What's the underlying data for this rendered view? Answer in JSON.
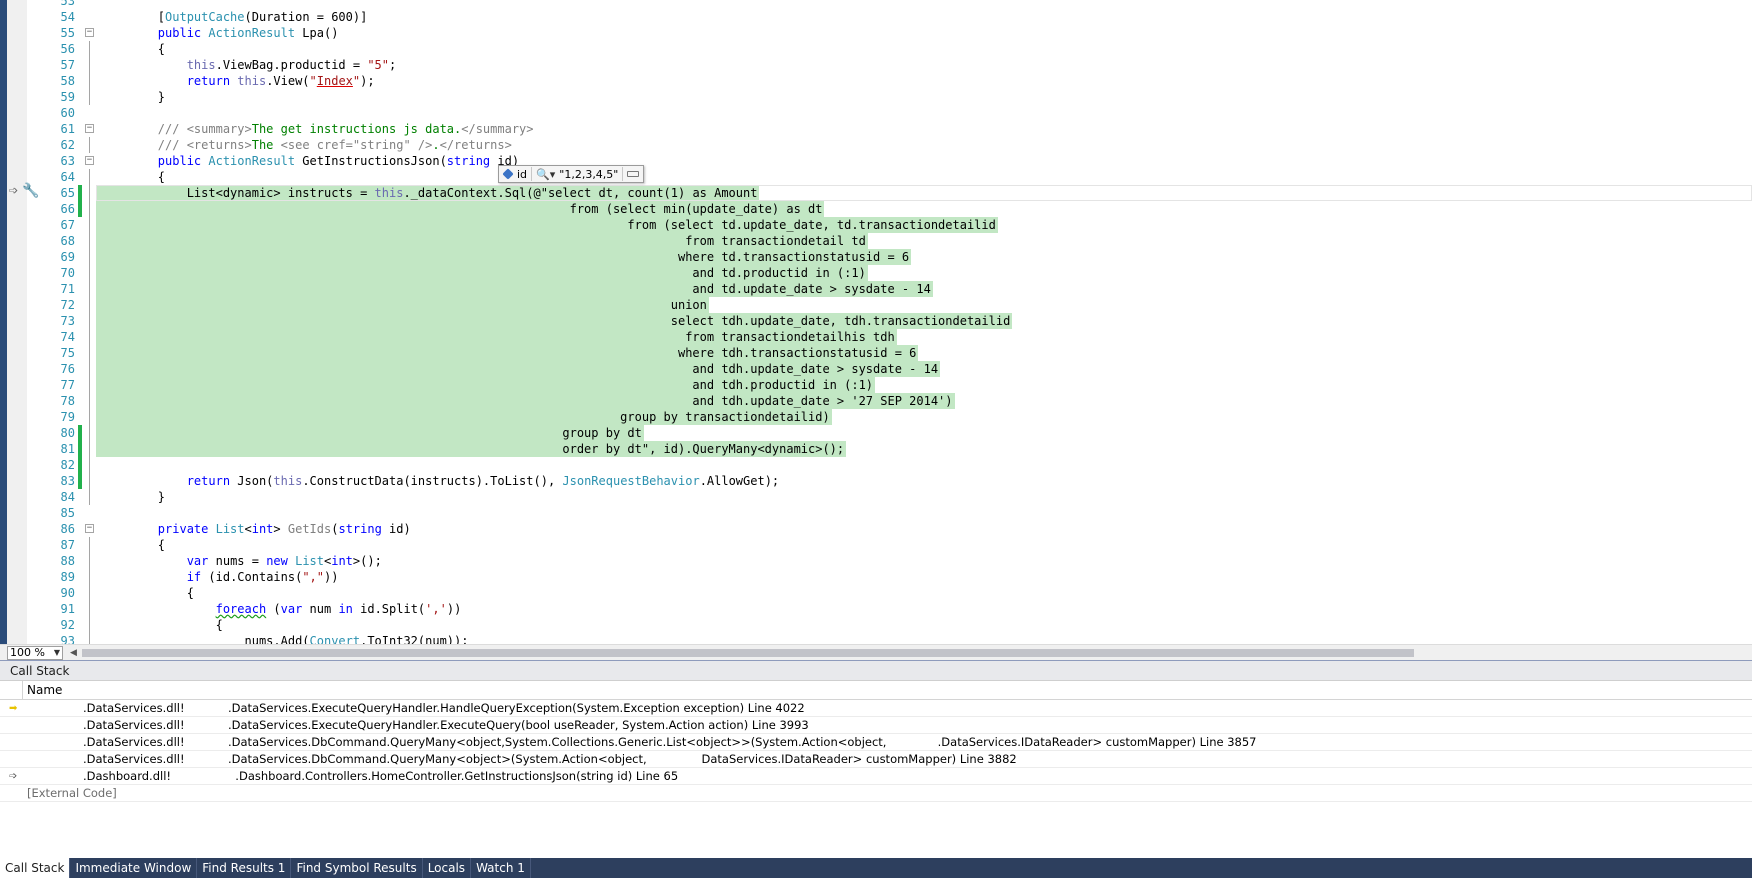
{
  "editor": {
    "lines": [
      {
        "n": "53",
        "tokens": [],
        "fold": "",
        "chg": "",
        "hl": ""
      },
      {
        "n": "54",
        "tokens": [
          [
            "        [",
            "plain"
          ],
          [
            "OutputCache",
            "type"
          ],
          [
            "(Duration = 600)]",
            "plain"
          ]
        ],
        "fold": "",
        "chg": "",
        "hl": ""
      },
      {
        "n": "55",
        "tokens": [
          [
            "        ",
            "plain"
          ],
          [
            "public ",
            "kw"
          ],
          [
            "ActionResult",
            "type"
          ],
          [
            " Lpa()",
            "plain"
          ]
        ],
        "fold": "minus",
        "chg": "",
        "hl": ""
      },
      {
        "n": "56",
        "tokens": [
          [
            "        {",
            "plain"
          ]
        ],
        "fold": "line",
        "chg": "",
        "hl": ""
      },
      {
        "n": "57",
        "tokens": [
          [
            "            ",
            "plain"
          ],
          [
            "this",
            "thisk"
          ],
          [
            ".ViewBag.productid = ",
            "plain"
          ],
          [
            "\"5\"",
            "str"
          ],
          [
            ";",
            "plain"
          ]
        ],
        "fold": "line",
        "chg": "",
        "hl": ""
      },
      {
        "n": "58",
        "tokens": [
          [
            "            ",
            "plain"
          ],
          [
            "return ",
            "kw"
          ],
          [
            "this",
            "thisk"
          ],
          [
            ".View(",
            "plain"
          ],
          [
            "\"",
            "str"
          ],
          [
            "Index",
            "str-u"
          ],
          [
            "\"",
            "str"
          ],
          [
            ");",
            "plain"
          ]
        ],
        "fold": "line",
        "chg": "",
        "hl": ""
      },
      {
        "n": "59",
        "tokens": [
          [
            "        }",
            "plain"
          ]
        ],
        "fold": "line",
        "chg": "",
        "hl": ""
      },
      {
        "n": "60",
        "tokens": [],
        "fold": "",
        "chg": "",
        "hl": ""
      },
      {
        "n": "61",
        "tokens": [
          [
            "        ",
            "plain"
          ],
          [
            "/// ",
            "tag"
          ],
          [
            "<summary>",
            "tag"
          ],
          [
            "The get instructions js data.",
            "cmt"
          ],
          [
            "</summary>",
            "tag"
          ]
        ],
        "fold": "minus",
        "chg": "",
        "hl": ""
      },
      {
        "n": "62",
        "tokens": [
          [
            "        ",
            "plain"
          ],
          [
            "/// ",
            "tag"
          ],
          [
            "<returns>",
            "tag"
          ],
          [
            "The ",
            "cmt"
          ],
          [
            "<see cref=\"string\" />",
            "tag"
          ],
          [
            ".",
            "cmt"
          ],
          [
            "</returns>",
            "tag"
          ]
        ],
        "fold": "line",
        "chg": "",
        "hl": ""
      },
      {
        "n": "63",
        "tokens": [
          [
            "        ",
            "plain"
          ],
          [
            "public ",
            "kw"
          ],
          [
            "ActionResult",
            "type"
          ],
          [
            " GetInstructionsJson(",
            "plain"
          ],
          [
            "string",
            "kw"
          ],
          [
            " id)",
            "plain"
          ]
        ],
        "fold": "minus",
        "chg": "",
        "hl": ""
      },
      {
        "n": "64",
        "tokens": [
          [
            "        {",
            "plain"
          ]
        ],
        "fold": "line",
        "chg": "",
        "hl": ""
      },
      {
        "n": "65",
        "tokens": [
          [
            "            List<dynamic> instructs = ",
            "plain"
          ],
          [
            "this",
            "thisk"
          ],
          [
            "._dataContext.Sql(@\"select dt, count(1) as Amount",
            "plain"
          ]
        ],
        "fold": "line",
        "chg": "saved",
        "hl": "cur"
      },
      {
        "n": "66",
        "tokens": [
          [
            "                                                                 from (select min(update_date) as dt",
            "plain"
          ]
        ],
        "fold": "line",
        "chg": "saved",
        "hl": "sel"
      },
      {
        "n": "67",
        "tokens": [
          [
            "                                                                         from (select td.update_date, td.transactiondetailid",
            "plain"
          ]
        ],
        "fold": "line",
        "chg": "",
        "hl": "sel"
      },
      {
        "n": "68",
        "tokens": [
          [
            "                                                                                 from transactiondetail td",
            "plain"
          ]
        ],
        "fold": "line",
        "chg": "",
        "hl": "sel"
      },
      {
        "n": "69",
        "tokens": [
          [
            "                                                                                where td.transactionstatusid = 6",
            "plain"
          ]
        ],
        "fold": "line",
        "chg": "",
        "hl": "sel"
      },
      {
        "n": "70",
        "tokens": [
          [
            "                                                                                  and td.productid in (:1)",
            "plain"
          ]
        ],
        "fold": "line",
        "chg": "",
        "hl": "sel"
      },
      {
        "n": "71",
        "tokens": [
          [
            "                                                                                  and td.update_date > sysdate - 14",
            "plain"
          ]
        ],
        "fold": "line",
        "chg": "",
        "hl": "sel"
      },
      {
        "n": "72",
        "tokens": [
          [
            "                                                                               union",
            "plain"
          ]
        ],
        "fold": "line",
        "chg": "",
        "hl": "sel"
      },
      {
        "n": "73",
        "tokens": [
          [
            "                                                                               select tdh.update_date, tdh.transactiondetailid",
            "plain"
          ]
        ],
        "fold": "line",
        "chg": "",
        "hl": "sel"
      },
      {
        "n": "74",
        "tokens": [
          [
            "                                                                                 from transactiondetailhis tdh",
            "plain"
          ]
        ],
        "fold": "line",
        "chg": "",
        "hl": "sel"
      },
      {
        "n": "75",
        "tokens": [
          [
            "                                                                                where tdh.transactionstatusid = 6",
            "plain"
          ]
        ],
        "fold": "line",
        "chg": "",
        "hl": "sel"
      },
      {
        "n": "76",
        "tokens": [
          [
            "                                                                                  and tdh.update_date > sysdate - 14",
            "plain"
          ]
        ],
        "fold": "line",
        "chg": "",
        "hl": "sel"
      },
      {
        "n": "77",
        "tokens": [
          [
            "                                                                                  and tdh.productid in (:1)",
            "plain"
          ]
        ],
        "fold": "line",
        "chg": "",
        "hl": "sel"
      },
      {
        "n": "78",
        "tokens": [
          [
            "                                                                                  and tdh.update_date > '27 SEP 2014')",
            "plain"
          ]
        ],
        "fold": "line",
        "chg": "",
        "hl": "sel"
      },
      {
        "n": "79",
        "tokens": [
          [
            "                                                                        group by transactiondetailid)",
            "plain"
          ]
        ],
        "fold": "line",
        "chg": "",
        "hl": "sel"
      },
      {
        "n": "80",
        "tokens": [
          [
            "                                                                group by dt",
            "plain"
          ]
        ],
        "fold": "line",
        "chg": "saved",
        "hl": "sel"
      },
      {
        "n": "81",
        "tokens": [
          [
            "                                                                order by dt\", id).QueryMany<dynamic>();",
            "plain"
          ]
        ],
        "fold": "line",
        "chg": "saved",
        "hl": "sel"
      },
      {
        "n": "82",
        "tokens": [],
        "fold": "line",
        "chg": "saved",
        "hl": ""
      },
      {
        "n": "83",
        "tokens": [
          [
            "            ",
            "plain"
          ],
          [
            "return ",
            "kw"
          ],
          [
            "Json(",
            "plain"
          ],
          [
            "this",
            "thisk"
          ],
          [
            ".ConstructData(instructs).ToList(), ",
            "plain"
          ],
          [
            "JsonRequestBehavior",
            "type"
          ],
          [
            ".AllowGet);",
            "plain"
          ]
        ],
        "fold": "line",
        "chg": "saved",
        "hl": ""
      },
      {
        "n": "84",
        "tokens": [
          [
            "        }",
            "plain"
          ]
        ],
        "fold": "line",
        "chg": "",
        "hl": ""
      },
      {
        "n": "85",
        "tokens": [],
        "fold": "",
        "chg": "",
        "hl": ""
      },
      {
        "n": "86",
        "tokens": [
          [
            "        ",
            "plain"
          ],
          [
            "private ",
            "kw"
          ],
          [
            "List",
            "type"
          ],
          [
            "<",
            "plain"
          ],
          [
            "int",
            "kw"
          ],
          [
            "> ",
            "plain"
          ],
          [
            "GetIds",
            "gray"
          ],
          [
            "(",
            "plain"
          ],
          [
            "string",
            "kw"
          ],
          [
            " id)",
            "plain"
          ]
        ],
        "fold": "minus",
        "chg": "",
        "hl": ""
      },
      {
        "n": "87",
        "tokens": [
          [
            "        {",
            "plain"
          ]
        ],
        "fold": "line",
        "chg": "",
        "hl": ""
      },
      {
        "n": "88",
        "tokens": [
          [
            "            ",
            "plain"
          ],
          [
            "var",
            "kw"
          ],
          [
            " nums = ",
            "plain"
          ],
          [
            "new ",
            "kw"
          ],
          [
            "List",
            "type"
          ],
          [
            "<",
            "plain"
          ],
          [
            "int",
            "kw"
          ],
          [
            ">();",
            "plain"
          ]
        ],
        "fold": "line",
        "chg": "",
        "hl": ""
      },
      {
        "n": "89",
        "tokens": [
          [
            "            ",
            "plain"
          ],
          [
            "if ",
            "kw"
          ],
          [
            "(id.Contains(",
            "plain"
          ],
          [
            "\",\"",
            "str"
          ],
          [
            "))",
            "plain"
          ]
        ],
        "fold": "line",
        "chg": "",
        "hl": ""
      },
      {
        "n": "90",
        "tokens": [
          [
            "            {",
            "plain"
          ]
        ],
        "fold": "line",
        "chg": "",
        "hl": ""
      },
      {
        "n": "91",
        "tokens": [
          [
            "                ",
            "plain"
          ],
          [
            "foreach",
            "kw-w"
          ],
          [
            " (",
            "plain"
          ],
          [
            "var",
            "kw"
          ],
          [
            " num ",
            "plain"
          ],
          [
            "in ",
            "kw"
          ],
          [
            "id.Split(",
            "plain"
          ],
          [
            "','",
            "str"
          ],
          [
            "))",
            "plain"
          ]
        ],
        "fold": "line",
        "chg": "",
        "hl": ""
      },
      {
        "n": "92",
        "tokens": [
          [
            "                {",
            "plain"
          ]
        ],
        "fold": "line",
        "chg": "",
        "hl": ""
      },
      {
        "n": "93",
        "tokens": [
          [
            "                    nums.Add(",
            "plain"
          ],
          [
            "Convert",
            "type"
          ],
          [
            ".ToInt32(num));",
            "plain"
          ]
        ],
        "fold": "line",
        "chg": "",
        "hl": ""
      }
    ],
    "datatip": {
      "name": "id",
      "value": "\"1,2,3,4,5\""
    },
    "zoom": "100 %"
  },
  "callstack": {
    "title": "Call Stack",
    "column_name": "Name",
    "rows": [
      {
        "icon": "current",
        "module": ".DataServices.dll!",
        "frame": ".DataServices.ExecuteQueryHandler.HandleQueryException(System.Exception exception) Line 4022"
      },
      {
        "icon": "",
        "module": ".DataServices.dll!",
        "frame": ".DataServices.ExecuteQueryHandler.ExecuteQuery(bool useReader, System.Action action) Line 3993"
      },
      {
        "icon": "",
        "module": ".DataServices.dll!",
        "frame": ".DataServices.DbCommand.QueryMany<object,System.Collections.Generic.List<object>>(System.Action<object,              .DataServices.IDataReader> customMapper) Line 3857"
      },
      {
        "icon": "",
        "module": ".DataServices.dll!",
        "frame": ".DataServices.DbCommand.QueryMany<object>(System.Action<object,               DataServices.IDataReader> customMapper) Line 3882"
      },
      {
        "icon": "return",
        "module": ".Dashboard.dll!",
        "frame": "  .Dashboard.Controllers.HomeController.GetInstructionsJson(string id) Line 65"
      }
    ],
    "external": "[External Code]"
  },
  "tabs": [
    {
      "label": "Call Stack",
      "active": true
    },
    {
      "label": "Immediate Window",
      "active": false
    },
    {
      "label": "Find Results 1",
      "active": false
    },
    {
      "label": "Find Symbol Results",
      "active": false
    },
    {
      "label": "Locals",
      "active": false
    },
    {
      "label": "Watch 1",
      "active": false
    }
  ]
}
